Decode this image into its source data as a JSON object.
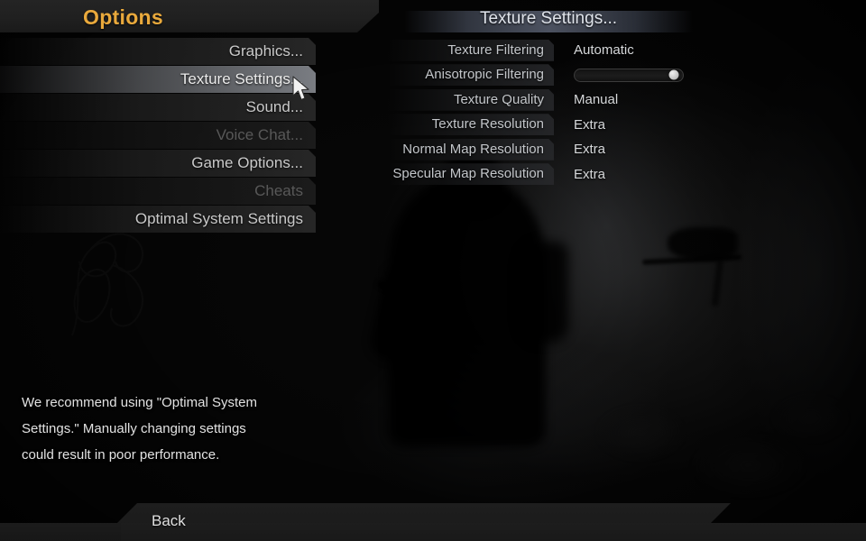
{
  "header": {
    "title": "Options"
  },
  "menu": {
    "items": [
      {
        "label": "Graphics...",
        "state": "normal"
      },
      {
        "label": "Texture Settings...",
        "state": "selected"
      },
      {
        "label": "Sound...",
        "state": "normal"
      },
      {
        "label": "Voice Chat...",
        "state": "disabled"
      },
      {
        "label": "Game Options...",
        "state": "normal"
      },
      {
        "label": "Cheats",
        "state": "disabled"
      },
      {
        "label": "Optimal System Settings",
        "state": "normal"
      }
    ]
  },
  "panel": {
    "title": "Texture Settings...",
    "rows": [
      {
        "label": "Texture Filtering",
        "value": "Automatic",
        "type": "value"
      },
      {
        "label": "Anisotropic Filtering",
        "value": "",
        "type": "slider",
        "slider_percent": 92
      },
      {
        "label": "Texture Quality",
        "value": "Manual",
        "type": "value"
      },
      {
        "label": "Texture Resolution",
        "value": "Extra",
        "type": "value"
      },
      {
        "label": "Normal Map Resolution",
        "value": "Extra",
        "type": "value"
      },
      {
        "label": "Specular Map Resolution",
        "value": "Extra",
        "type": "value"
      }
    ]
  },
  "recommendation": {
    "line1": "We recommend using \"Optimal System",
    "line2": "Settings.\"  Manually changing settings",
    "line3": "could result in poor performance."
  },
  "footer": {
    "back_label": "Back"
  },
  "cursor": {
    "icon": "mouse-pointer-icon"
  },
  "colors": {
    "title_gold": "#e9a93c",
    "menu_text": "#c9c9c9",
    "disabled_text": "#585858",
    "panel_title": "#dfe3ea",
    "value_text": "#d6d8da"
  }
}
